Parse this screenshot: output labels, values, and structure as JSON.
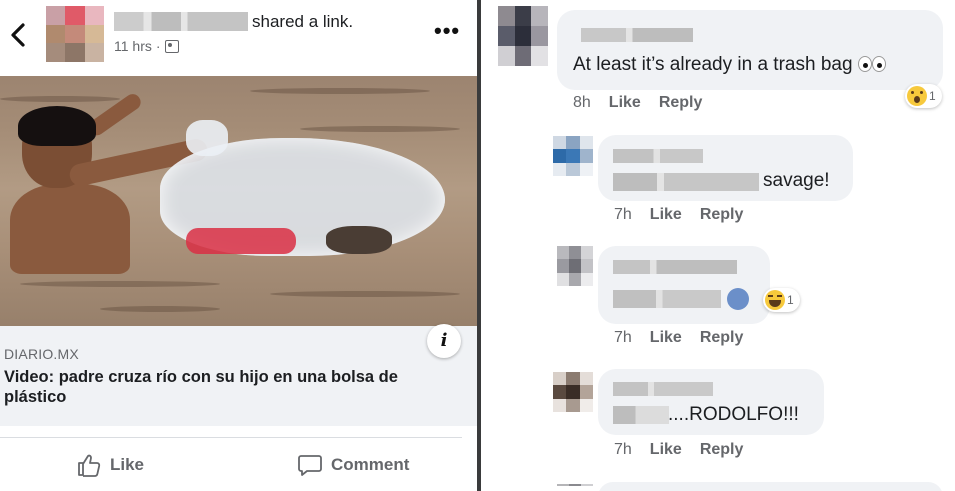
{
  "post": {
    "back_icon": "chevron-left-icon",
    "action_text": "shared a link.",
    "time": "11 hrs",
    "time_separator": "·",
    "audience_icon": "friends-icon",
    "more_label": "•••"
  },
  "link": {
    "domain": "DIARIO.MX",
    "title": "Video: padre cruza río con su hijo en una bolsa de plástico",
    "info_label": "i"
  },
  "actions": {
    "like_label": "Like",
    "comment_label": "Comment"
  },
  "comments": [
    {
      "text": "At least it’s already in a trash bag",
      "time": "8h",
      "like": "Like",
      "reply": "Reply",
      "reaction": "wow",
      "reaction_count": "1"
    },
    {
      "text": "savage!",
      "time": "7h",
      "like": "Like",
      "reply": "Reply"
    },
    {
      "text": "",
      "time": "7h",
      "like": "Like",
      "reply": "Reply",
      "reaction": "haha",
      "reaction_count": "1"
    },
    {
      "text": "....RODOLFO!!!",
      "time": "7h",
      "like": "Like",
      "reply": "Reply"
    }
  ]
}
